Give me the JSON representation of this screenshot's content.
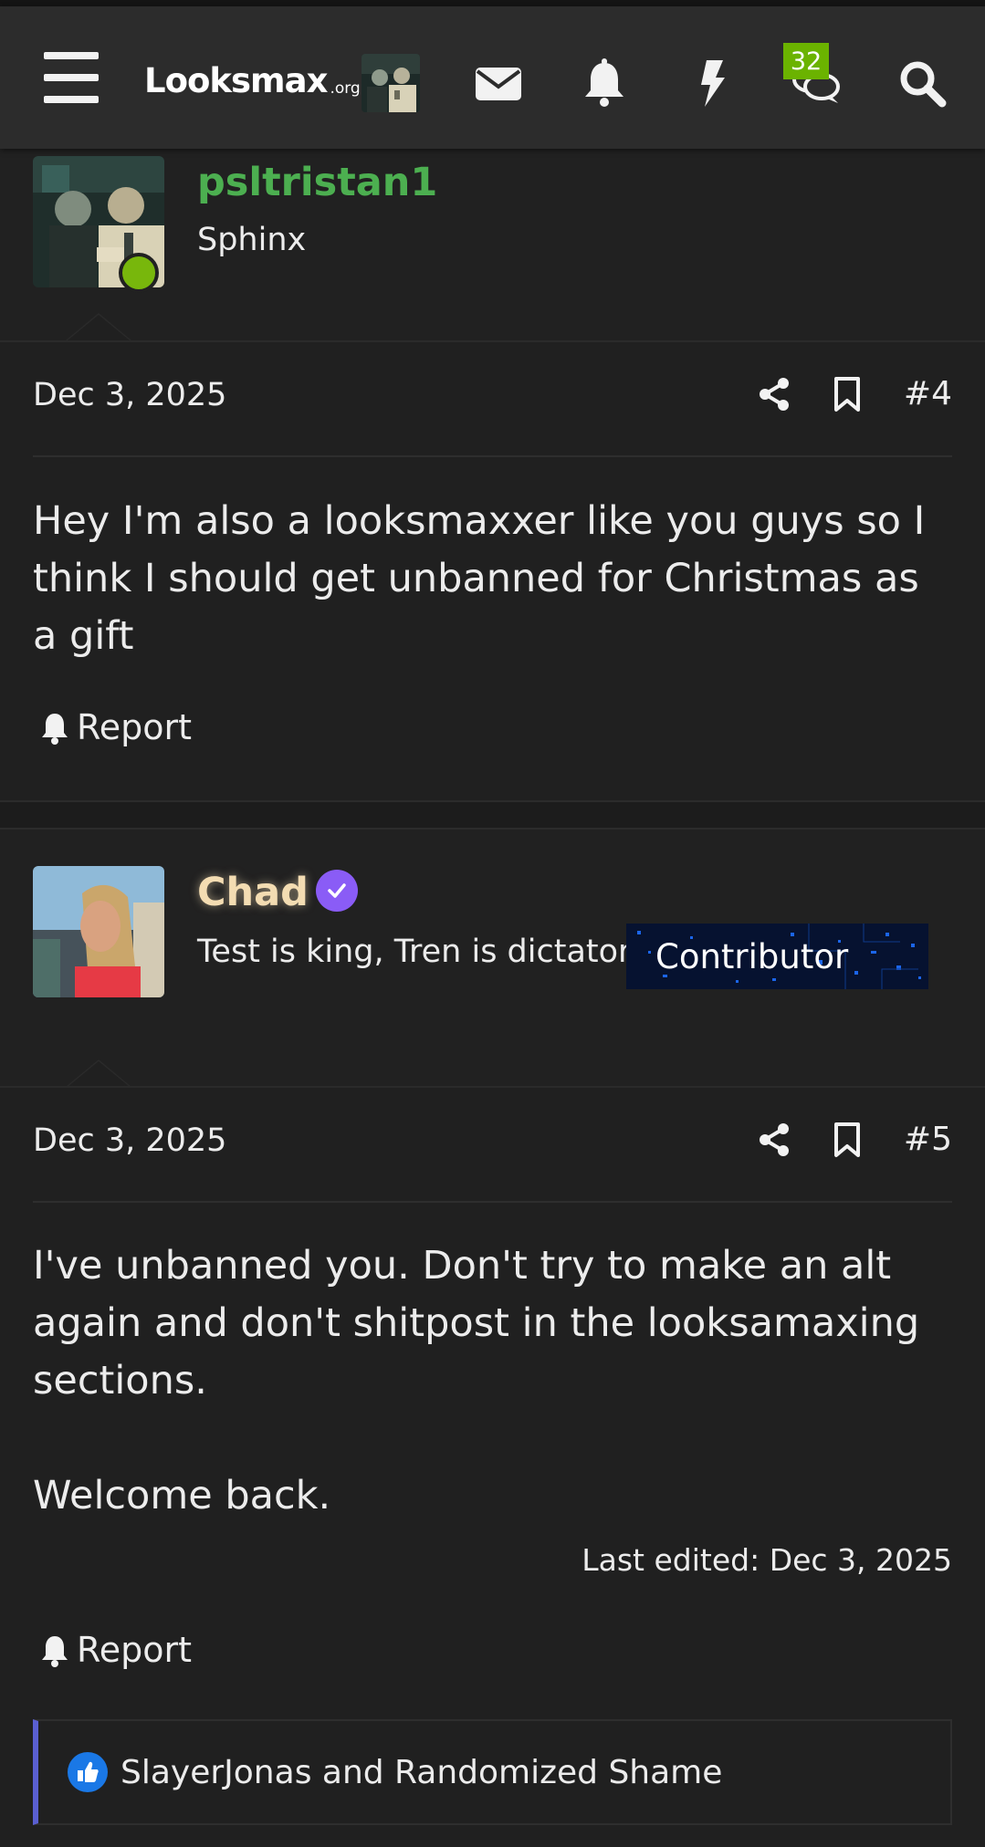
{
  "navbar": {
    "logo": {
      "main": "Looksmax",
      "tld": ".org"
    },
    "badge_count": "32",
    "icons": [
      "menu-icon",
      "envelope-icon",
      "bell-icon",
      "bolt-icon",
      "chat-bubbles-icon",
      "search-icon"
    ]
  },
  "posts": [
    {
      "username": "psltristan1",
      "username_color": "#4caf50",
      "user_title": "Sphinx",
      "date": "Dec 3, 2025",
      "post_number": "#4",
      "body": "Hey I'm also a looksmaxxer like you guys so I think I should get unbanned for Christmas as a gift",
      "report_label": "Report"
    },
    {
      "username": "Chad",
      "username_color": "#f3dcb2",
      "user_title": "Test is king, Tren is dictator.",
      "banner": "Contributor",
      "date": "Dec 3, 2025",
      "post_number": "#5",
      "body_lines": [
        "I've unbanned you. Don't try to make an alt again and don't shitpost in the looksamaxing sections.",
        "Welcome back."
      ],
      "last_edited": "Last edited: Dec 3, 2025",
      "report_label": "Report",
      "reactions": "SlayerJonas and Randomized Shame"
    }
  ],
  "colors": {
    "background": "#212121",
    "navbar": "#2c2c2c",
    "badge": "#6bb300",
    "verified": "#8a5cf6",
    "reaction_border": "#5a5fd1",
    "like": "#1a78e6"
  }
}
